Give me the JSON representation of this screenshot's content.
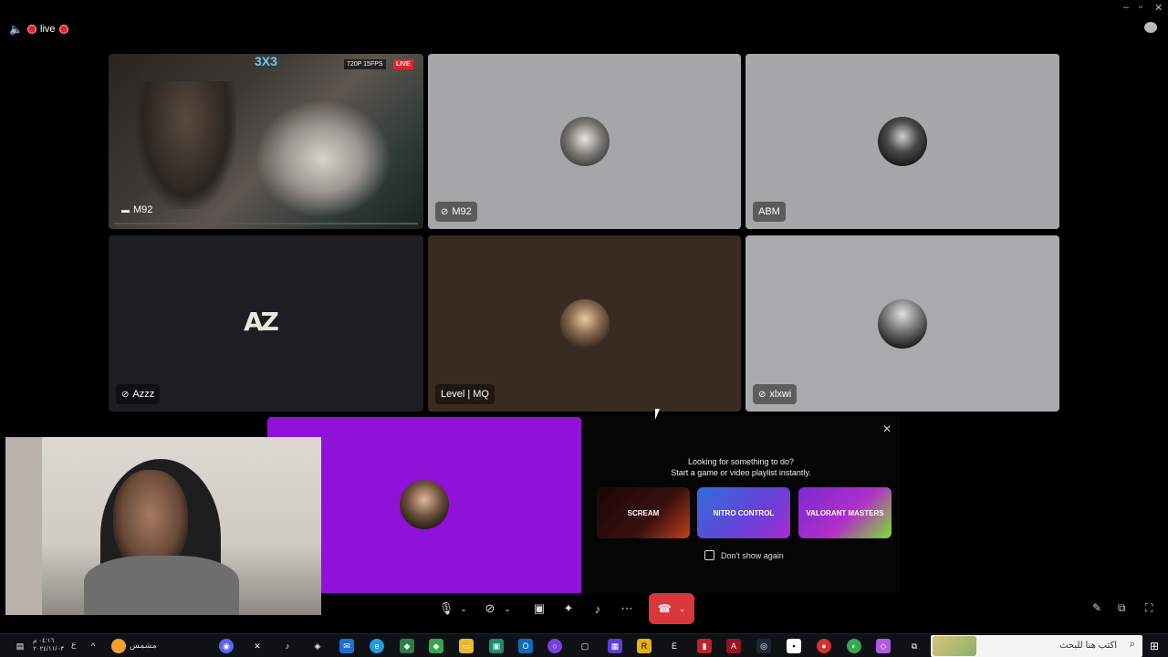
{
  "top": {
    "live_label": "live"
  },
  "tiles": [
    {
      "name": "M92",
      "type": "stream",
      "badge_quality": "720P 15FPS",
      "badge_live": "LIVE"
    },
    {
      "name": "M92",
      "type": "avatar",
      "bg": "#a4a6a7"
    },
    {
      "name": "ABM",
      "type": "avatar",
      "bg": "#a6a7a8"
    },
    {
      "name": "Azzz",
      "type": "logo",
      "bg": "#1d1e22",
      "logo_text": "AZ"
    },
    {
      "name": "Level | MQ",
      "type": "avatar",
      "bg": "#3a2b22"
    },
    {
      "name": "xlxwi",
      "type": "avatar",
      "bg": "#a9aaab"
    }
  ],
  "self_tile": {
    "bg": "#8f12d9"
  },
  "activity": {
    "line1": "Looking for something to do?",
    "line2": "Start a game or video playlist instantly.",
    "cards": [
      {
        "label": "SCREAM",
        "bg": "#2a0d0d"
      },
      {
        "label": "NITRO CONTROL",
        "bg": "#4a3fd0"
      },
      {
        "label": "VALORANT MASTERS",
        "bg": "#8f2bd4"
      }
    ],
    "checkbox_label": "Don't show again"
  },
  "taskbar": {
    "search_placeholder": "اكتب هنا للبحث",
    "weather_label": "مشمس",
    "time": "٠٤:١٦ م",
    "date": "٢٠٢٤/١١/٠٣",
    "lang": "ع"
  },
  "colors": {
    "end_call": "#da373c",
    "self_tile": "#8f12d9"
  }
}
